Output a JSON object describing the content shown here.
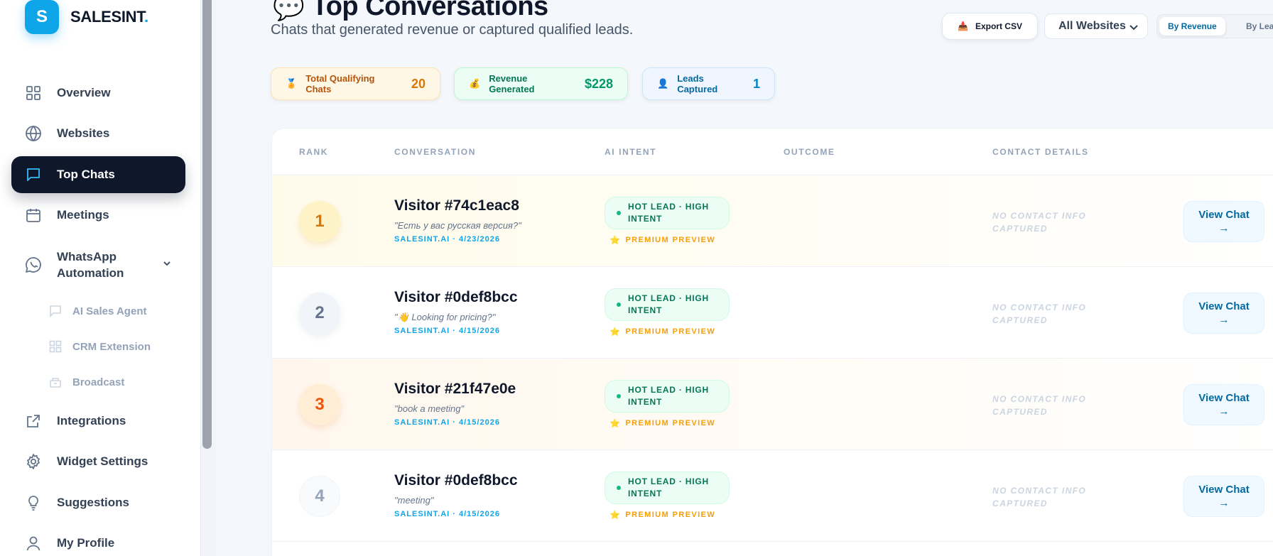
{
  "brand": {
    "logo_letter": "S",
    "name": "SALESINT",
    "dot": "."
  },
  "nav": {
    "overview": "Overview",
    "websites": "Websites",
    "top_chats": "Top Chats",
    "meetings": "Meetings",
    "whatsapp": "WhatsApp Automation",
    "ai_sales_agent": "AI Sales Agent",
    "crm_extension": "CRM Extension",
    "broadcast": "Broadcast",
    "integrations": "Integrations",
    "widget_settings": "Widget Settings",
    "suggestions": "Suggestions",
    "my_profile": "My Profile"
  },
  "header": {
    "title_emoji": "💬",
    "title": "Top Conversations",
    "subtitle": "Chats that generated revenue or captured qualified leads.",
    "export_label": "Export CSV",
    "website_filter": "All Websites",
    "sort_by_revenue": "By Revenue",
    "sort_by_leads": "By Leads"
  },
  "stats": {
    "qualifying": {
      "icon": "🏅",
      "label": "Total Qualifying Chats",
      "value": "20"
    },
    "revenue": {
      "icon": "💰",
      "label": "Revenue Generated",
      "value": "$228"
    },
    "leads": {
      "icon": "👤",
      "label": "Leads Captured",
      "value": "1"
    }
  },
  "table": {
    "headers": {
      "rank": "RANK",
      "conversation": "CONVERSATION",
      "ai_intent": "AI INTENT",
      "outcome": "OUTCOME",
      "contact": "CONTACT DETAILS"
    },
    "rows": [
      {
        "rank": "1",
        "visitor": "Visitor #74c1eac8",
        "quote": "\"Есть у вас русская версия?\"",
        "meta": "SALESINT.AI · 4/23/2026",
        "intent": "HOT LEAD · HIGH INTENT",
        "premium": "PREMIUM PREVIEW",
        "contact": "NO CONTACT INFO CAPTURED",
        "action_line1": "View Chat",
        "action_line2": "→"
      },
      {
        "rank": "2",
        "visitor": "Visitor #0def8bcc",
        "quote": "\"👋 Looking for pricing?\"",
        "meta": "SALESINT.AI · 4/15/2026",
        "intent": "HOT LEAD · HIGH INTENT",
        "premium": "PREMIUM PREVIEW",
        "contact": "NO CONTACT INFO CAPTURED",
        "action_line1": "View Chat",
        "action_line2": "→"
      },
      {
        "rank": "3",
        "visitor": "Visitor #21f47e0e",
        "quote": "\"book a meeting\"",
        "meta": "SALESINT.AI · 4/15/2026",
        "intent": "HOT LEAD · HIGH INTENT",
        "premium": "PREMIUM PREVIEW",
        "contact": "NO CONTACT INFO CAPTURED",
        "action_line1": "View Chat",
        "action_line2": "→"
      },
      {
        "rank": "4",
        "visitor": "Visitor #0def8bcc",
        "quote": "\"meeting\"",
        "meta": "SALESINT.AI · 4/15/2026",
        "intent": "HOT LEAD · HIGH INTENT",
        "premium": "PREMIUM PREVIEW",
        "contact": "NO CONTACT INFO CAPTURED",
        "action_line1": "View Chat",
        "action_line2": "→"
      }
    ]
  },
  "colors": {
    "accent": "#0ea5e9",
    "active_nav": "#0f172a",
    "hot_lead": "#047857",
    "premium": "#f59e0b"
  }
}
